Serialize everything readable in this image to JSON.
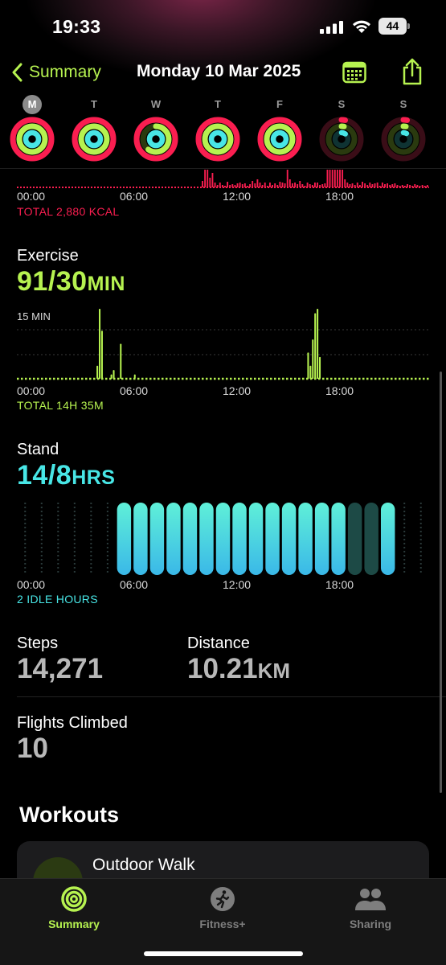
{
  "status_bar": {
    "time": "19:33",
    "battery": "44"
  },
  "nav": {
    "back_label": "Summary",
    "title": "Monday 10 Mar 2025"
  },
  "week": {
    "days": [
      {
        "label": "M",
        "selected": true,
        "move": 1.0,
        "exercise": 1.0,
        "stand": 1.0
      },
      {
        "label": "T",
        "selected": false,
        "move": 1.0,
        "exercise": 1.0,
        "stand": 1.0
      },
      {
        "label": "W",
        "selected": false,
        "move": 1.0,
        "exercise": 0.6,
        "stand": 1.0
      },
      {
        "label": "T",
        "selected": false,
        "move": 1.0,
        "exercise": 1.0,
        "stand": 1.0
      },
      {
        "label": "F",
        "selected": false,
        "move": 1.0,
        "exercise": 1.0,
        "stand": 1.0
      },
      {
        "label": "S",
        "selected": false,
        "move": 0.03,
        "exercise": 0.03,
        "stand": 0.1
      },
      {
        "label": "S",
        "selected": false,
        "move": 0.03,
        "exercise": 0.03,
        "stand": 0.08
      }
    ]
  },
  "axis_ticks": [
    "00:00",
    "06:00",
    "12:00",
    "18:00"
  ],
  "move": {
    "total": "TOTAL 2,880 KCAL"
  },
  "exercise": {
    "title": "Exercise",
    "value": "91/30",
    "unit": "MIN",
    "scale_label": "15 MIN",
    "total": "TOTAL 14H 35M"
  },
  "stand": {
    "title": "Stand",
    "value": "14/8",
    "unit": "HRS",
    "idle": "2 IDLE HOURS"
  },
  "steps": {
    "label": "Steps",
    "value": "14,271"
  },
  "distance": {
    "label": "Distance",
    "value": "10.21",
    "unit": "KM"
  },
  "flights": {
    "label": "Flights Climbed",
    "value": "10"
  },
  "workouts": {
    "title": "Workouts",
    "items": [
      {
        "name": "Outdoor Walk"
      }
    ]
  },
  "tabs": [
    {
      "label": "Summary",
      "active": true
    },
    {
      "label": "Fitness+",
      "active": false
    },
    {
      "label": "Sharing",
      "active": false
    }
  ],
  "colors": {
    "move": "#fa1e50",
    "exercise": "#b6f250",
    "stand": "#48e6e6",
    "accent": "#b6f250"
  },
  "chart_data": [
    {
      "type": "bar",
      "title": "Move",
      "x_ticks": [
        "00:00",
        "06:00",
        "12:00",
        "18:00"
      ],
      "values": [
        0,
        0,
        0,
        0,
        0,
        0,
        0,
        0,
        0,
        0,
        0,
        0,
        0,
        0,
        0,
        0,
        0,
        0,
        0,
        0,
        0,
        0,
        0,
        0,
        0,
        0,
        0,
        0,
        0,
        0,
        0,
        0,
        0,
        0,
        0,
        0,
        0,
        0,
        0,
        0,
        0,
        0,
        0,
        0,
        0,
        0,
        0,
        0,
        0,
        0,
        0,
        0,
        0,
        0,
        0,
        0,
        0,
        0,
        0,
        0,
        0,
        0,
        0,
        0,
        0,
        0,
        0,
        0,
        0,
        0,
        0,
        0,
        0,
        0,
        8,
        22,
        22,
        12,
        18,
        6,
        3,
        6,
        3,
        2,
        7,
        3,
        4,
        3,
        5,
        6,
        4,
        5,
        2,
        4,
        8,
        5,
        10,
        6,
        3,
        6,
        2,
        6,
        3,
        5,
        3,
        7,
        6,
        5,
        22,
        10,
        5,
        6,
        4,
        8,
        4,
        2,
        6,
        4,
        3,
        6,
        6,
        3,
        4,
        5,
        22,
        22,
        22,
        22,
        22,
        22,
        22,
        10,
        6,
        4,
        5,
        3,
        6,
        3,
        7,
        5,
        3,
        6,
        4,
        5,
        6,
        2,
        6,
        4,
        5,
        3,
        4,
        5,
        3,
        2,
        3,
        2,
        4,
        3,
        2,
        4,
        3,
        2,
        3,
        2,
        3
      ],
      "total": "TOTAL 2,880 KCAL"
    },
    {
      "type": "bar",
      "title": "Exercise",
      "x_ticks": [
        "00:00",
        "06:00",
        "12:00",
        "18:00"
      ],
      "scale_label": "15 MIN",
      "max": 15,
      "values": [
        0,
        0,
        0,
        0,
        0,
        0,
        0,
        0,
        0,
        0,
        0,
        0,
        0,
        0,
        0,
        0,
        0,
        0,
        0,
        0,
        0,
        0,
        0,
        0,
        0,
        0,
        0,
        0,
        0,
        0,
        0,
        0,
        0,
        0,
        3,
        16,
        11,
        0,
        0,
        0,
        1,
        2,
        0,
        0,
        8,
        0,
        0,
        0,
        0,
        0,
        1,
        0,
        0,
        0,
        0,
        0,
        0,
        0,
        0,
        0,
        0,
        0,
        0,
        0,
        0,
        0,
        0,
        0,
        0,
        0,
        0,
        0,
        0,
        0,
        0,
        0,
        0,
        0,
        0,
        0,
        0,
        0,
        0,
        0,
        0,
        0,
        0,
        0,
        0,
        0,
        0,
        0,
        0,
        0,
        0,
        0,
        0,
        0,
        0,
        0,
        0,
        0,
        0,
        0,
        0,
        0,
        0,
        0,
        0,
        0,
        0,
        0,
        0,
        0,
        0,
        0,
        0,
        0,
        0,
        0,
        0,
        0,
        0,
        0,
        6,
        3,
        9,
        15,
        16,
        5,
        0,
        0,
        0,
        0,
        0,
        0,
        0,
        0,
        0,
        0,
        0,
        0,
        0,
        0,
        0,
        0,
        0,
        0,
        0,
        0,
        0,
        0,
        0,
        0,
        0,
        0,
        0,
        0,
        0,
        0,
        0,
        0,
        0,
        0,
        0,
        0,
        0,
        0,
        0,
        0,
        0,
        0,
        0,
        0,
        0,
        0
      ],
      "total": "TOTAL 14H 35M"
    },
    {
      "type": "bar",
      "title": "Stand",
      "x_ticks": [
        "00:00",
        "06:00",
        "12:00",
        "18:00"
      ],
      "hours": [
        0,
        0,
        0,
        0,
        0,
        0,
        1,
        1,
        1,
        1,
        1,
        1,
        1,
        1,
        1,
        1,
        1,
        1,
        1,
        1,
        0.5,
        0.5,
        1,
        0,
        0
      ],
      "total": "2 IDLE HOURS"
    }
  ]
}
